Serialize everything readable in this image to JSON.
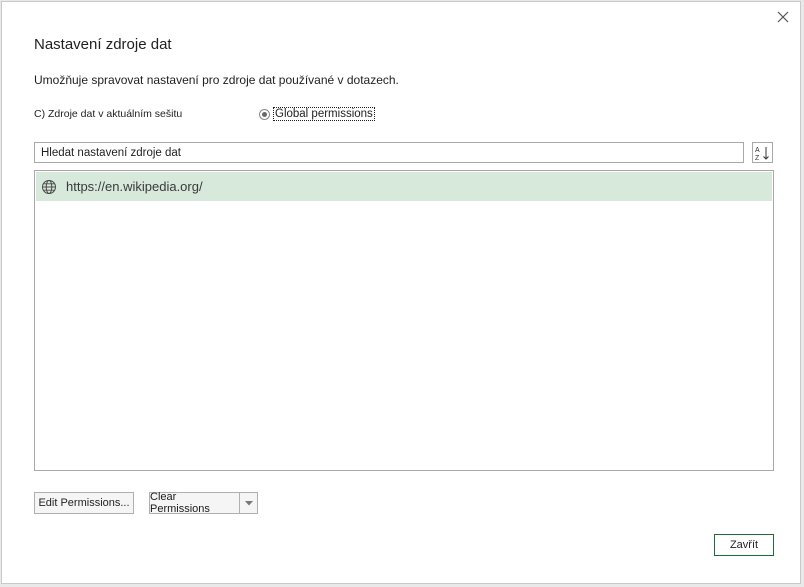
{
  "dialog": {
    "title": "Nastavení zdroje dat",
    "description": "Umožňuje spravovat nastavení pro zdroje dat používané v dotazech."
  },
  "scope": {
    "current_workbook_label": "C) Zdroje dat v aktuálním sešitu",
    "global_label": "Global permissions",
    "selected": "global"
  },
  "search": {
    "placeholder": "Hledat nastavení zdroje dat"
  },
  "sort_icon": "sort-az-icon",
  "sources": [
    {
      "url": "https://en.wikipedia.org/",
      "icon": "globe-icon",
      "selected": true
    }
  ],
  "buttons": {
    "edit_permissions": "Edit Permissions...",
    "clear_permissions": "Clear Permissions",
    "close": "Zavřít"
  },
  "colors": {
    "selection": "#d6e9da",
    "primary_border": "#1e6b35"
  }
}
